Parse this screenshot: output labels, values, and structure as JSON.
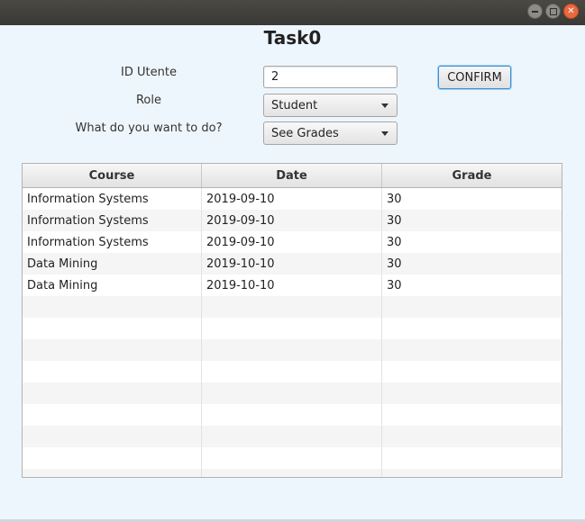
{
  "window": {
    "buttons": [
      "minimize",
      "maximize",
      "close"
    ]
  },
  "app": {
    "title": "Task0"
  },
  "form": {
    "id_label": "ID Utente",
    "id_value": "2",
    "role_label": "Role",
    "role_value": "Student",
    "action_label": "What do you want to do?",
    "action_value": "See Grades",
    "confirm_label": "CONFIRM"
  },
  "table": {
    "columns": [
      "Course",
      "Date",
      "Grade"
    ],
    "rows": [
      [
        "Information Systems",
        "2019-09-10",
        "30"
      ],
      [
        "Information Systems",
        "2019-09-10",
        "30"
      ],
      [
        "Information Systems",
        "2019-09-10",
        "30"
      ],
      [
        "Data Mining",
        "2019-10-10",
        "30"
      ],
      [
        "Data Mining",
        "2019-10-10",
        "30"
      ]
    ]
  },
  "colors": {
    "background": "#eef6fd",
    "titlebar": "#3f3e3a",
    "close_button": "#e9683d",
    "focus_border": "#3a8fd3"
  },
  "icons": [
    "minimize-icon",
    "maximize-icon",
    "close-icon",
    "dropdown-arrow-icon"
  ]
}
